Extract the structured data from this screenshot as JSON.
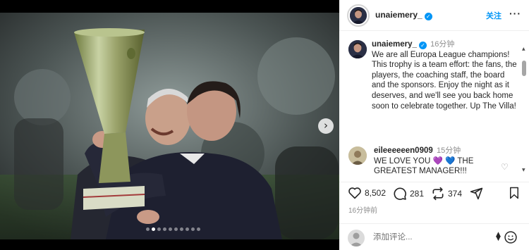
{
  "post": {
    "username": "unaiemery_",
    "follow_label": "关注",
    "more_label": "···",
    "caption": "We are all Europa League champions! This trophy is a team effort: the fans, the players, the coaching staff, the board and the sponsors. Enjoy the night as it deserves, and we'll see you back home soon to celebrate together. Up The Villa!",
    "caption_time": "16分钟",
    "likes": "8,502",
    "comments_count": "281",
    "reposts": "374",
    "posted_time": "16分钟前"
  },
  "carousel": {
    "total_dots": 10,
    "active_dot": 1,
    "next_arrow": "›"
  },
  "comments": [
    {
      "username": "eileeeeeen0909",
      "time": "15分钟",
      "text_before": "WE LOVE YOU ",
      "emoji_1": "💜",
      "emoji_2": "💙",
      "text_after": " THE GREATEST MANAGER!!!"
    }
  ],
  "composer": {
    "placeholder": "添加评论..."
  },
  "icons": {
    "verified": "verified-badge-icon",
    "like": "heart-icon",
    "comment": "comment-bubble-icon",
    "repost": "repost-icon",
    "share": "send-icon",
    "save": "bookmark-icon",
    "emoji": "emoji-smiley-icon"
  },
  "colors": {
    "accent": "#0095f6",
    "muted": "#8e8e8e",
    "border": "#efefef"
  }
}
